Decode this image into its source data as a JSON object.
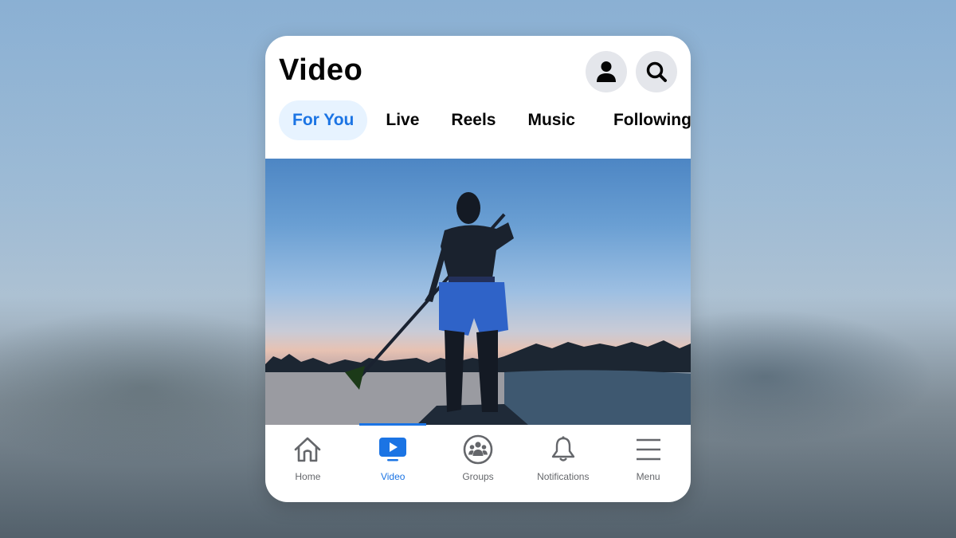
{
  "header": {
    "title": "Video",
    "profile_icon": "person-icon",
    "search_icon": "search-icon"
  },
  "tabs": [
    {
      "label": "For You",
      "active": true
    },
    {
      "label": "Live",
      "active": false
    },
    {
      "label": "Reels",
      "active": false
    },
    {
      "label": "Music",
      "active": false
    },
    {
      "label": "Following",
      "active": false
    }
  ],
  "video": {
    "description": "Silhouette of a man stand-up paddleboarding at sunset on a lake"
  },
  "bottom_nav": [
    {
      "label": "Home",
      "icon": "home-icon",
      "active": false
    },
    {
      "label": "Video",
      "icon": "video-icon",
      "active": true
    },
    {
      "label": "Groups",
      "icon": "groups-icon",
      "active": false
    },
    {
      "label": "Notifications",
      "icon": "bell-icon",
      "active": false
    },
    {
      "label": "Menu",
      "icon": "menu-icon",
      "active": false
    }
  ],
  "colors": {
    "accent": "#1b74e4",
    "active_tab_bg": "#e7f3ff",
    "icon_button_bg": "#e4e6eb",
    "inactive_label": "#65676b"
  }
}
